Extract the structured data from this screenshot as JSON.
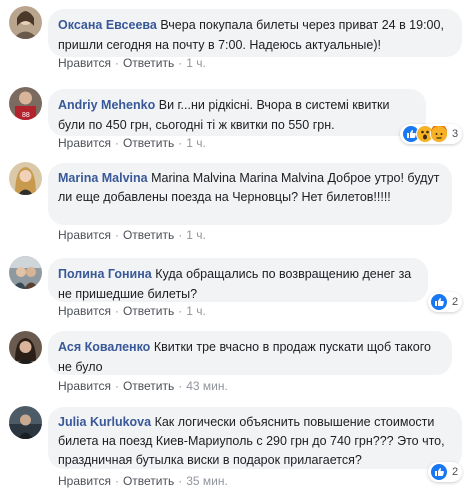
{
  "labels": {
    "like": "Нравится",
    "reply": "Ответить",
    "sep": "·"
  },
  "comments": [
    {
      "author": "Оксана Евсеева",
      "text": "Вчера покупала билеты через приват 24 в 19:00, пришли сегодня на почту в 7:00. Надеюсь актуальные)!",
      "time": "1 ч."
    },
    {
      "author": "Andriy Mehenko",
      "text": "Ви г...ни рідкісні. Вчора в системі квитки були по 450 грн, сьогодні ті ж квитки по 550 грн.",
      "time": "1 ч.",
      "reactions": {
        "icons": [
          "like-icon",
          "wow-icon",
          "angry-icon"
        ],
        "count": "3"
      }
    },
    {
      "author": "Marina Malvina",
      "text": "Marina Malvina Marina Malvina Доброе утро! будут ли еще добавлены поезда на Черновцы? Нет билетов!!!!!",
      "time": "1 ч."
    },
    {
      "author": "Полина Гонина",
      "text": "Куда обращались по возвращению денег за не пришедшие билеты?",
      "time": "1 ч.",
      "reactions": {
        "icons": [
          "like-icon"
        ],
        "count": "2"
      }
    },
    {
      "author": "Ася Коваленко",
      "text": "Квитки тре вчасно в продаж пускати щоб такого не було",
      "time": "43 мин."
    },
    {
      "author": "Julia Kurlukova",
      "text": "Как логически объяснить повышение стоимости билета на поезд Киев-Мариуполь с 290 грн до 740 грн??? Это что, праздничная бутылка виски в подарок прилагается?",
      "time": "35 мин.",
      "reactions": {
        "icons": [
          "like-icon"
        ],
        "count": "2"
      }
    }
  ],
  "colors": {
    "author": "#385898",
    "bubble": "#f2f3f5",
    "meta": "#90949c",
    "like": "#1877f2"
  }
}
